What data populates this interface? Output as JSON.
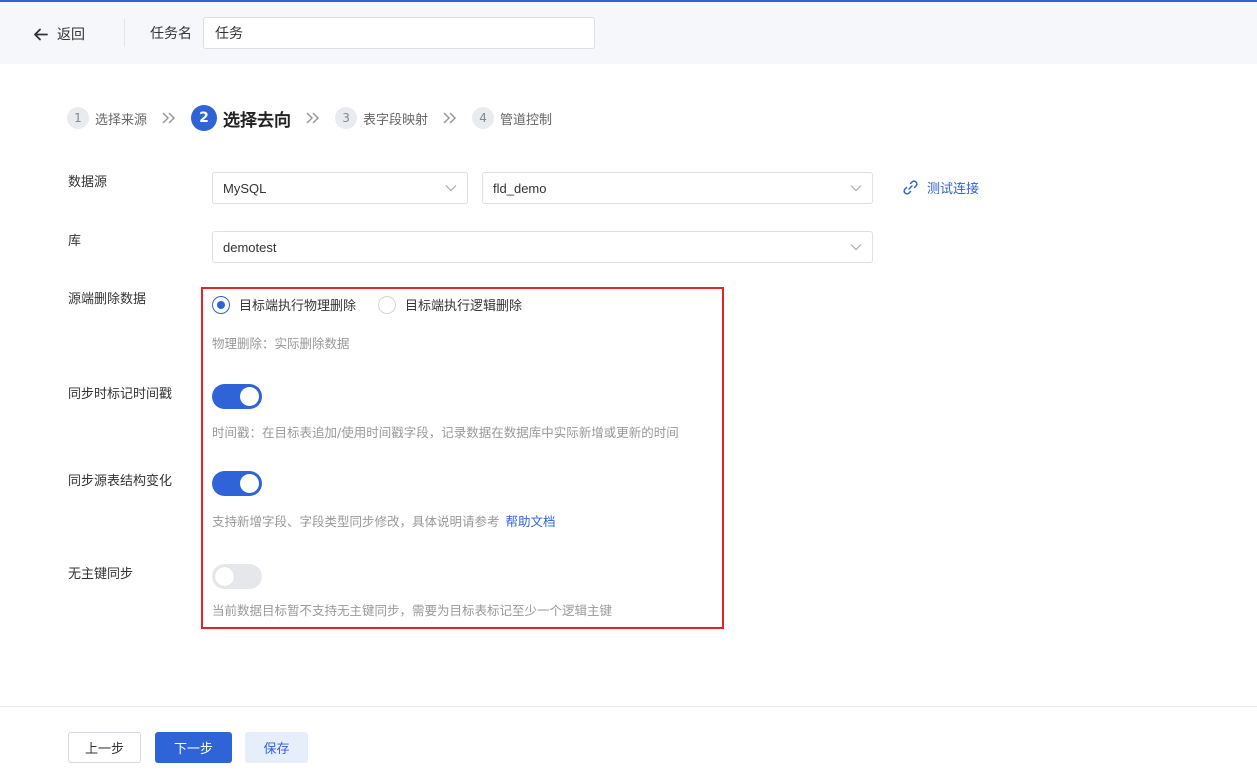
{
  "header": {
    "back_label": "返回",
    "task_name_label": "任务名",
    "task_name_value": "任务"
  },
  "steps": [
    {
      "num": "1",
      "label": "选择来源",
      "active": false
    },
    {
      "num": "2",
      "label": "选择去向",
      "active": true
    },
    {
      "num": "3",
      "label": "表字段映射",
      "active": false
    },
    {
      "num": "4",
      "label": "管道控制",
      "active": false
    }
  ],
  "datasource": {
    "label": "数据源",
    "type_value": "MySQL",
    "conn_value": "fld_demo",
    "test_link": "测试连接"
  },
  "database": {
    "label": "库",
    "value": "demotest"
  },
  "source_delete": {
    "label": "源端删除数据",
    "option_physical": "目标端执行物理删除",
    "option_logical": "目标端执行逻辑删除",
    "selected": "physical",
    "hint": "物理删除：实际删除数据"
  },
  "sync_timestamp": {
    "label": "同步时标记时间戳",
    "enabled": true,
    "hint": "时间戳：在目标表追加/使用时间戳字段，记录数据在数据库中实际新增或更新的时间"
  },
  "sync_schema": {
    "label": "同步源表结构变化",
    "enabled": true,
    "hint": "支持新增字段、字段类型同步修改，具体说明请参考",
    "help_link": "帮助文档"
  },
  "no_pk_sync": {
    "label": "无主键同步",
    "enabled": false,
    "hint": "当前数据目标暂不支持无主键同步，需要为目标表标记至少一个逻辑主键"
  },
  "footer": {
    "prev": "上一步",
    "next": "下一步",
    "save": "保存"
  },
  "colors": {
    "accent": "#2f63d8",
    "highlight_box": "#e0242d"
  }
}
